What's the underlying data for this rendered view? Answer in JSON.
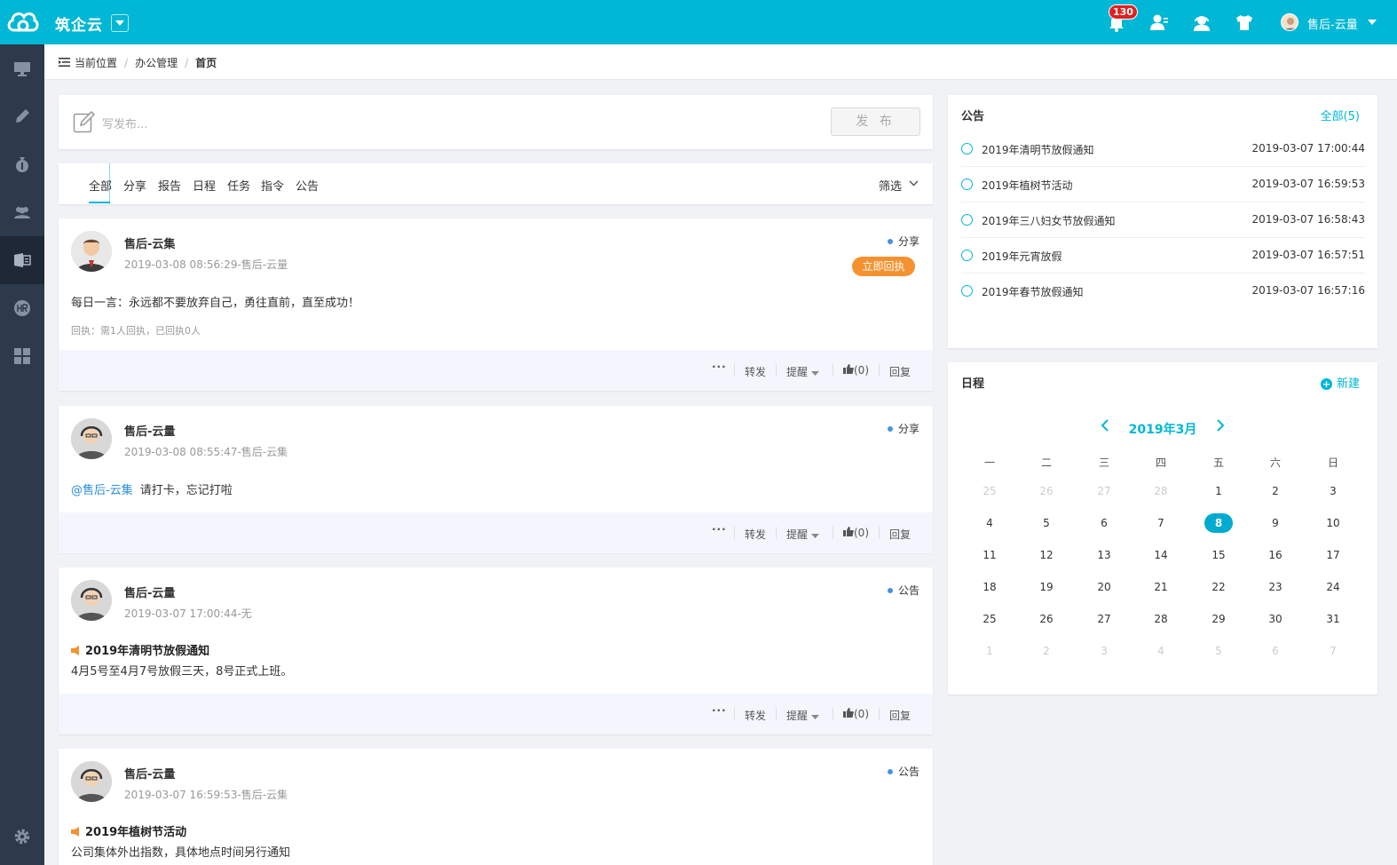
{
  "app": {
    "brand": "筑企云",
    "notification_count": "130",
    "user_name": "售后-云量"
  },
  "breadcrumb": {
    "label": "当前位置",
    "items": [
      "办公管理",
      "首页"
    ]
  },
  "compose": {
    "placeholder": "写发布...",
    "publish_label": "发 布"
  },
  "tabs": {
    "items": [
      "全部",
      "分享",
      "报告",
      "日程",
      "任务",
      "指令",
      "公告"
    ],
    "active": "全部",
    "filter_label": "筛选"
  },
  "actions": {
    "more": "···",
    "forward": "转发",
    "remind": "提醒",
    "like": "(0)",
    "reply": "回复"
  },
  "posts": [
    {
      "author": "售后-云集",
      "meta": "2019-03-08 08:56:29-售后-云量",
      "type": "分享",
      "receipt_button": "立即回执",
      "body": "每日一言：永远都不要放弃自己，勇往直前，直至成功！",
      "receipt_status": "回执：需1人回执，已回执0人"
    },
    {
      "author": "售后-云量",
      "meta": "2019-03-08 08:55:47-售后-云集",
      "type": "分享",
      "mention": "@售后-云集",
      "body": "请打卡，忘记打啦"
    },
    {
      "author": "售后-云量",
      "meta": "2019-03-07 17:00:44-无",
      "type": "公告",
      "notice_title": "2019年清明节放假通知",
      "body": "4月5号至4月7号放假三天，8号正式上班。"
    },
    {
      "author": "售后-云量",
      "meta": "2019-03-07 16:59:53-售后-云集",
      "type": "公告",
      "notice_title": "2019年植树节活动",
      "body": "公司集体外出指数，具体地点时间另行通知"
    }
  ],
  "notices": {
    "title": "公告",
    "all_link": "全部(5)",
    "items": [
      {
        "title": "2019年清明节放假通知",
        "date": "2019-03-07 17:00:44"
      },
      {
        "title": "2019年植树节活动",
        "date": "2019-03-07 16:59:53"
      },
      {
        "title": "2019年三八妇女节放假通知",
        "date": "2019-03-07 16:58:43"
      },
      {
        "title": "2019年元宵放假",
        "date": "2019-03-07 16:57:51"
      },
      {
        "title": "2019年春节放假通知",
        "date": "2019-03-07 16:57:16"
      }
    ]
  },
  "schedule": {
    "title": "日程",
    "new_label": "新建",
    "month": "2019年3月",
    "weekdays": [
      "一",
      "二",
      "三",
      "四",
      "五",
      "六",
      "日"
    ],
    "weeks": [
      [
        "25",
        "26",
        "27",
        "28",
        "1",
        "2",
        "3"
      ],
      [
        "4",
        "5",
        "6",
        "7",
        "8",
        "9",
        "10"
      ],
      [
        "11",
        "12",
        "13",
        "14",
        "15",
        "16",
        "17"
      ],
      [
        "18",
        "19",
        "20",
        "21",
        "22",
        "23",
        "24"
      ],
      [
        "25",
        "26",
        "27",
        "28",
        "29",
        "30",
        "31"
      ],
      [
        "1",
        "2",
        "3",
        "4",
        "5",
        "6",
        "7"
      ]
    ],
    "today": "8",
    "colors": {
      "accent": "#00b7d6",
      "muted": "#cccccc"
    }
  },
  "colors": {
    "topbar": "#00b7d6",
    "sidebar": "#2d3a4b",
    "receipt_button": "#f5922f",
    "badge": "#e02020"
  }
}
